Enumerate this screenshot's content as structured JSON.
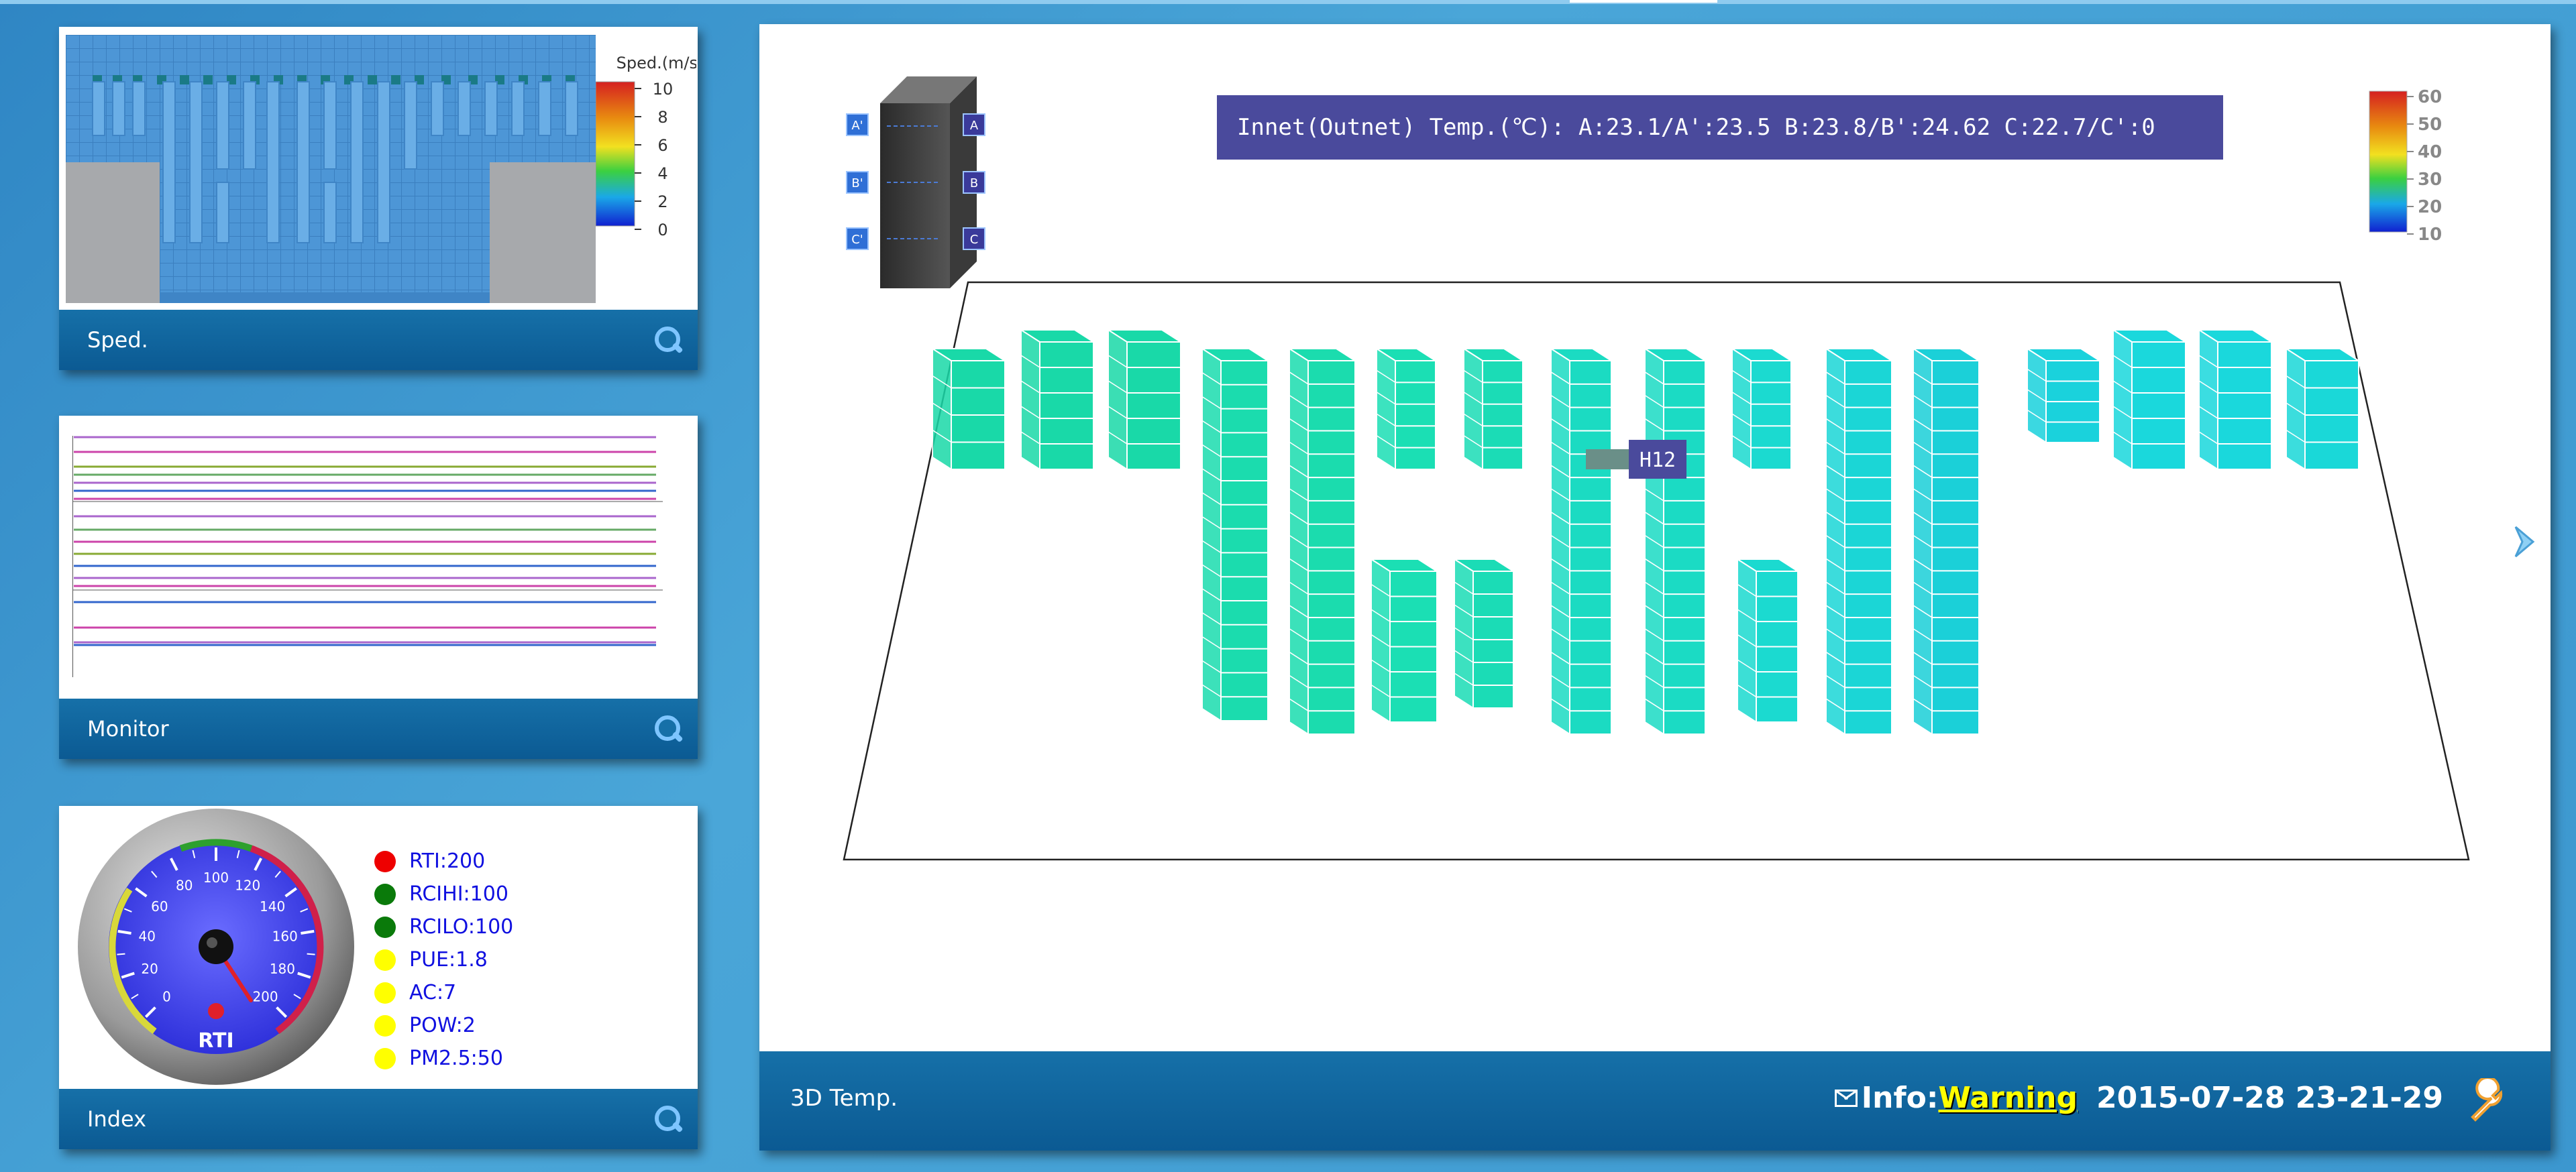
{
  "panels": {
    "speed": {
      "title": "Sped.",
      "legend_title": "Sped.(m/s)",
      "legend_ticks": [
        "10",
        "8",
        "6",
        "4",
        "2",
        "0"
      ]
    },
    "monitor": {
      "title": "Monitor"
    },
    "index": {
      "title": "Index",
      "gauge_label": "RTI",
      "gauge_ticks": [
        "0",
        "20",
        "40",
        "60",
        "80",
        "100",
        "120",
        "140",
        "160",
        "180",
        "200"
      ],
      "items": [
        {
          "label": "RTI:200",
          "color": "#ee0000"
        },
        {
          "label": "RCIHI:100",
          "color": "#0a7a0a"
        },
        {
          "label": "RCILO:100",
          "color": "#0a7a0a"
        },
        {
          "label": "PUE:1.8",
          "color": "#ffff00"
        },
        {
          "label": "AC:7",
          "color": "#ffff00"
        },
        {
          "label": "POW:2",
          "color": "#ffff00"
        },
        {
          "label": "PM2.5:50",
          "color": "#ffff00"
        }
      ]
    }
  },
  "main": {
    "title": "3D Temp.",
    "banner": "Innet(Outnet) Temp.(℃): A:23.1/A':23.5 B:23.8/B':24.62 C:22.7/C':0",
    "rack_labels_left": [
      "A'",
      "B'",
      "C'"
    ],
    "rack_labels_right": [
      "A",
      "B",
      "C"
    ],
    "legend_ticks": [
      "60",
      "50",
      "40",
      "30",
      "20",
      "10"
    ],
    "tooltip": "H12",
    "info_label": "Info:",
    "info_status": "Warning",
    "timestamp": "2015-07-28 23-21-29"
  },
  "colors": {
    "accent": "#0b5a93",
    "background": "#3c97cf",
    "warning": "#ffff00"
  },
  "icons": [
    "search-icon",
    "mail-icon",
    "wrench-icon",
    "chevron-right-icon"
  ]
}
